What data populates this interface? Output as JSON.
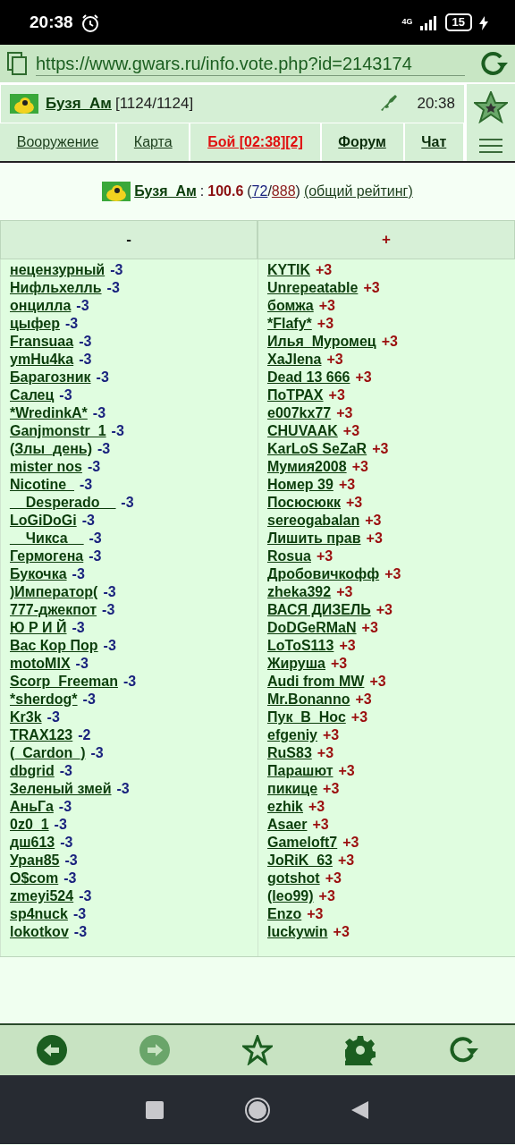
{
  "status_bar": {
    "time": "20:38",
    "network": "4G",
    "battery": "15"
  },
  "browser": {
    "url": "https://www.gwars.ru/info.vote.php?id=2143174"
  },
  "header": {
    "player": "Бузя_Ам",
    "hp": "[1124/1124]",
    "time": "20:38"
  },
  "tabs": [
    {
      "label": "Вооружение",
      "kind": "normal"
    },
    {
      "label": "Карта",
      "kind": "normal"
    },
    {
      "label": "Бой [02:38][2]",
      "kind": "alert"
    },
    {
      "label": "Форум",
      "kind": "bold"
    },
    {
      "label": "Чат",
      "kind": "bold"
    }
  ],
  "rating": {
    "player": "Бузя_Ам",
    "separator": ":",
    "score": "100.6",
    "open": "(",
    "positive": "72",
    "slash": "/",
    "total": "888",
    "close": ")",
    "link": "(общий рейтинг)"
  },
  "table": {
    "columns": [
      "-",
      "+"
    ],
    "minus": [
      {
        "name": "нецензурный",
        "vote": "-3"
      },
      {
        "name": "Нифльхелль",
        "vote": "-3"
      },
      {
        "name": "онцилла",
        "vote": "-3"
      },
      {
        "name": "цыфер",
        "vote": "-3"
      },
      {
        "name": "Fransuaa",
        "vote": "-3"
      },
      {
        "name": "ymHu4ka",
        "vote": "-3"
      },
      {
        "name": "Барагозник",
        "vote": "-3"
      },
      {
        "name": "Салец",
        "vote": "-3"
      },
      {
        "name": "*WredinkA*",
        "vote": "-3"
      },
      {
        "name": "Ganjmonstr_1",
        "vote": "-3"
      },
      {
        "name": "(Злы_день)",
        "vote": "-3"
      },
      {
        "name": "mister nos",
        "vote": "-3"
      },
      {
        "name": "Nicotine_",
        "vote": "-3"
      },
      {
        "name": "__Desperado__",
        "vote": "-3"
      },
      {
        "name": "LoGiDoGi",
        "vote": "-3"
      },
      {
        "name": "__Чикса__",
        "vote": "-3"
      },
      {
        "name": "Гермогена",
        "vote": "-3"
      },
      {
        "name": "Букочка",
        "vote": "-3"
      },
      {
        "name": ")Император(",
        "vote": "-3"
      },
      {
        "name": "777-джекпот",
        "vote": "-3"
      },
      {
        "name": "Ю Р И Й",
        "vote": "-3"
      },
      {
        "name": "Вас Кор Пор",
        "vote": "-3"
      },
      {
        "name": "motoMIX",
        "vote": "-3"
      },
      {
        "name": "Scorp_Freeman",
        "vote": "-3"
      },
      {
        "name": "*sherdog*",
        "vote": "-3"
      },
      {
        "name": "Kr3k",
        "vote": "-3"
      },
      {
        "name": "TRAX123",
        "vote": "-2"
      },
      {
        "name": "(_Cardon_)",
        "vote": "-3"
      },
      {
        "name": "dbgrid",
        "vote": "-3"
      },
      {
        "name": "Зеленый змей",
        "vote": "-3"
      },
      {
        "name": "АньГа",
        "vote": "-3"
      },
      {
        "name": "0z0_1",
        "vote": "-3"
      },
      {
        "name": "дш613",
        "vote": "-3"
      },
      {
        "name": "Уран85",
        "vote": "-3"
      },
      {
        "name": "O$com",
        "vote": "-3"
      },
      {
        "name": "zmeyi524",
        "vote": "-3"
      },
      {
        "name": "sp4nuck",
        "vote": "-3"
      },
      {
        "name": "lokotkov",
        "vote": "-3"
      }
    ],
    "plus": [
      {
        "name": "KYTIK",
        "vote": "+3"
      },
      {
        "name": "Unrepeatable",
        "vote": "+3"
      },
      {
        "name": "бомжа",
        "vote": "+3"
      },
      {
        "name": "*Flafy*",
        "vote": "+3"
      },
      {
        "name": "Илья_Муромец",
        "vote": "+3"
      },
      {
        "name": "XaJIena",
        "vote": "+3"
      },
      {
        "name": "Dead 13 666",
        "vote": "+3"
      },
      {
        "name": "ПоТРАХ",
        "vote": "+3"
      },
      {
        "name": "e007kx77",
        "vote": "+3"
      },
      {
        "name": "CHUVAAK",
        "vote": "+3"
      },
      {
        "name": "KarLoS SeZaR",
        "vote": "+3"
      },
      {
        "name": "Мумия2008",
        "vote": "+3"
      },
      {
        "name": "Номер 39",
        "vote": "+3"
      },
      {
        "name": "Посюсюкк",
        "vote": "+3"
      },
      {
        "name": "sereogabalan",
        "vote": "+3"
      },
      {
        "name": "Лишить прав",
        "vote": "+3"
      },
      {
        "name": "Rosua",
        "vote": "+3"
      },
      {
        "name": "Дробовичкофф",
        "vote": "+3"
      },
      {
        "name": "zheka392",
        "vote": "+3"
      },
      {
        "name": "ВАСЯ ДИЗЕЛЬ",
        "vote": "+3"
      },
      {
        "name": "DoDGeRMaN",
        "vote": "+3"
      },
      {
        "name": "LoToS113",
        "vote": "+3"
      },
      {
        "name": "Жируша",
        "vote": "+3"
      },
      {
        "name": "Audi from MW",
        "vote": "+3"
      },
      {
        "name": "Mr.Bonanno",
        "vote": "+3"
      },
      {
        "name": "Пук_В_Нос",
        "vote": "+3"
      },
      {
        "name": "efgeniy",
        "vote": "+3"
      },
      {
        "name": "RuS83",
        "vote": "+3"
      },
      {
        "name": "Парашют",
        "vote": "+3"
      },
      {
        "name": "пикице",
        "vote": "+3"
      },
      {
        "name": "ezhik",
        "vote": "+3"
      },
      {
        "name": "Asaer",
        "vote": "+3"
      },
      {
        "name": "Gameloft7",
        "vote": "+3"
      },
      {
        "name": "JoRiK_63",
        "vote": "+3"
      },
      {
        "name": "gotshot",
        "vote": "+3"
      },
      {
        "name": "(leo99)",
        "vote": "+3"
      },
      {
        "name": "Enzo",
        "vote": "+3"
      },
      {
        "name": "luckywin",
        "vote": "+3"
      }
    ]
  },
  "toolbar": [
    {
      "kind": "back",
      "disabled": false
    },
    {
      "kind": "forward",
      "disabled": true
    },
    {
      "kind": "star",
      "disabled": false
    },
    {
      "kind": "settings",
      "disabled": false
    },
    {
      "kind": "reload",
      "disabled": false
    }
  ]
}
